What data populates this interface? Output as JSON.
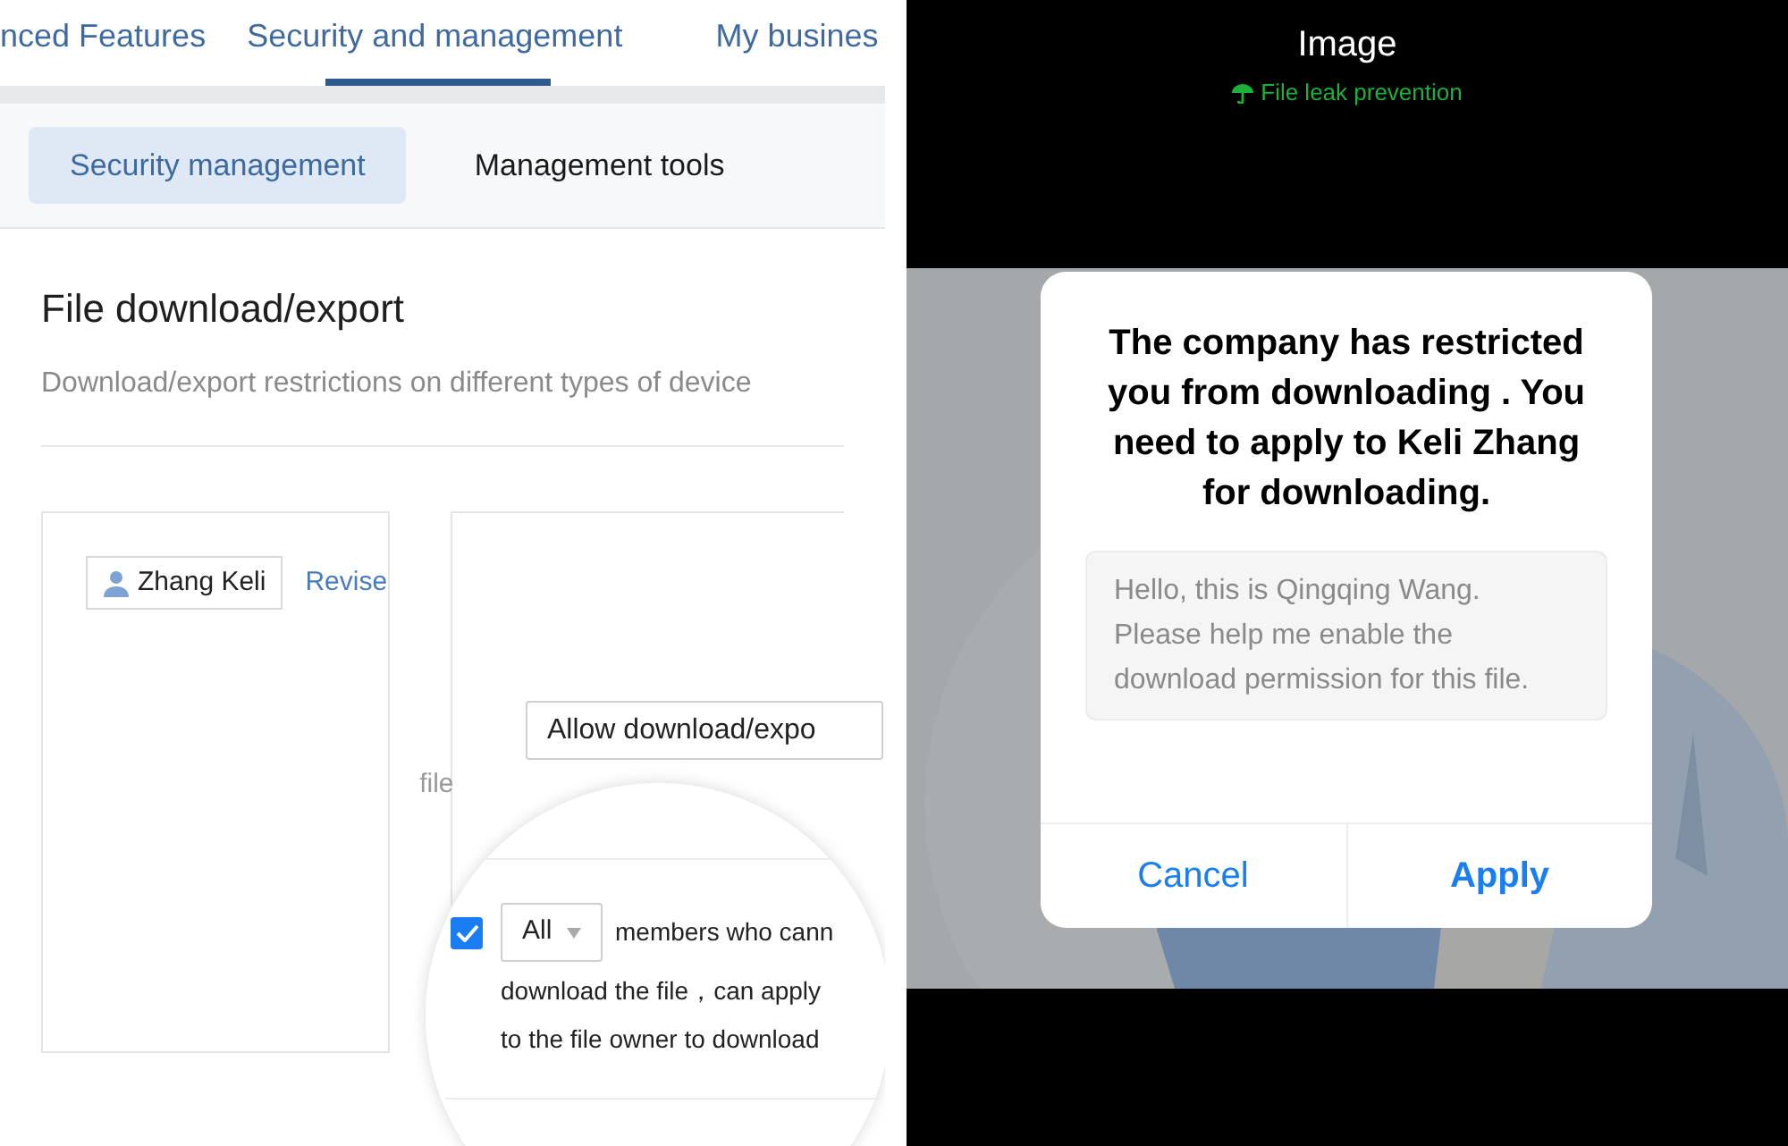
{
  "tabs": [
    {
      "label": "nced Features",
      "selected": false
    },
    {
      "label": "Security and management",
      "selected": true
    },
    {
      "label": "My busines",
      "selected": false
    }
  ],
  "subtabs": [
    {
      "label": "Security management",
      "selected": true
    },
    {
      "label": "Management tools",
      "selected": false
    }
  ],
  "section": {
    "title": "File download/export",
    "description": "Download/export restrictions on different types of device"
  },
  "member": {
    "name": "Zhang Keli",
    "link": "Revise"
  },
  "file_label": "file",
  "permission_select": {
    "value": "Allow download/expo"
  },
  "magnifier": {
    "checked": true,
    "scope_select": "All",
    "lines": [
      "members who cann",
      "download the file，can apply",
      "to the file owner to download"
    ]
  },
  "viewer": {
    "title": "Image",
    "subtitle": "File leak prevention"
  },
  "dialog": {
    "message": "The company has restricted you from downloading . You need to apply to Keli Zhang for downloading.",
    "request": "Hello, this is Qingqing Wang. Please help me enable the download permission for this file.",
    "buttons": [
      {
        "label": "Cancel",
        "kind": "secondary"
      },
      {
        "label": "Apply",
        "kind": "primary"
      }
    ]
  }
}
